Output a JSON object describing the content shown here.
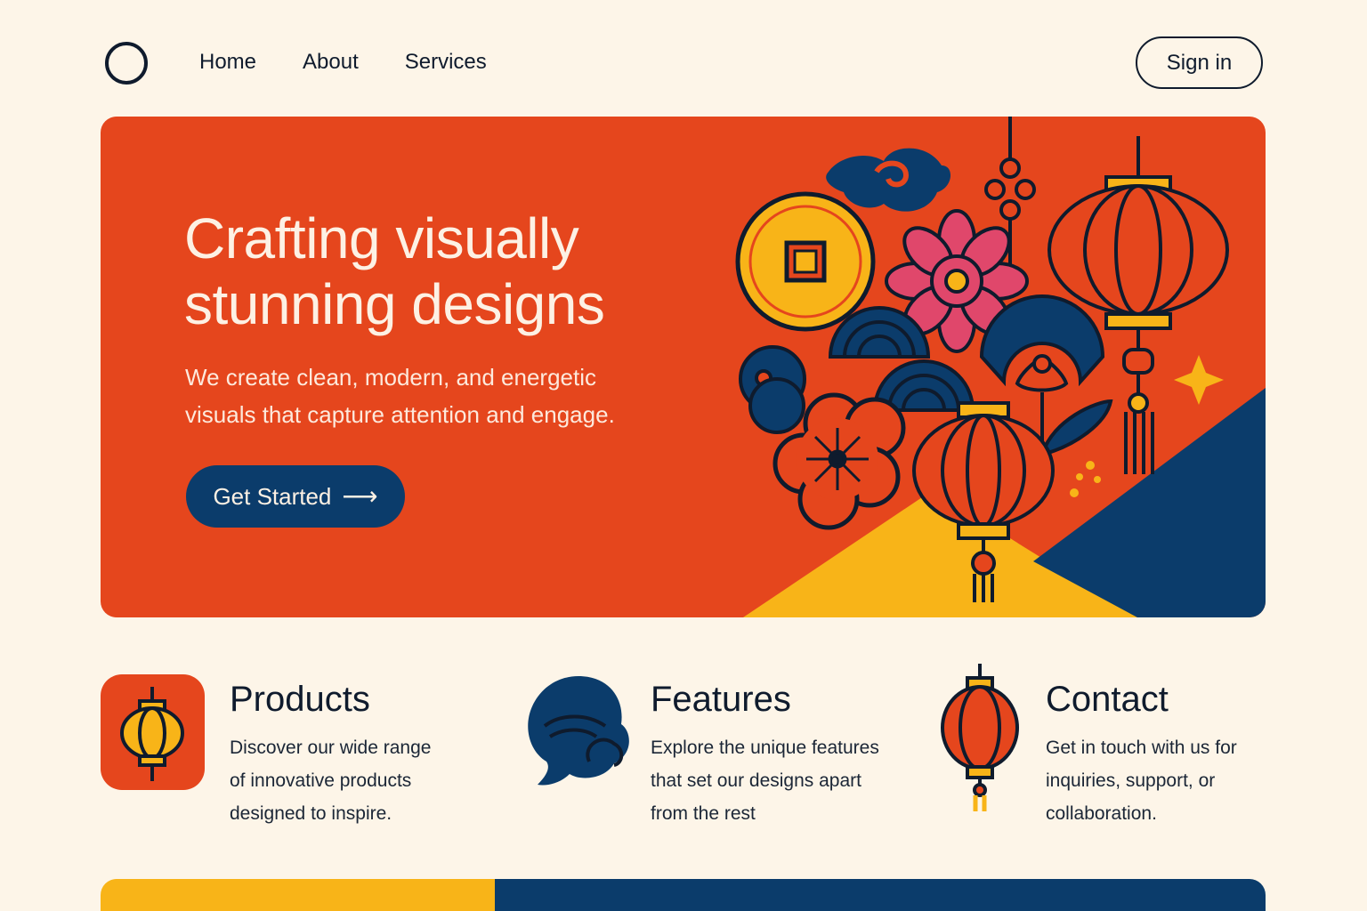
{
  "nav": {
    "links": [
      "Home",
      "About",
      "Services"
    ],
    "signin_label": "Sign in"
  },
  "hero": {
    "title_line1": "Crafting visually",
    "title_line2": "stunning designs",
    "subtitle_line1": "We create clean, modern, and energetic",
    "subtitle_line2": "visuals that capture attention and engage.",
    "cta_label": "Get Started",
    "cta_icon": "arrow-right-icon"
  },
  "features": [
    {
      "title": "Products",
      "desc": [
        "Discover our wide range",
        "of innovative products",
        "designed to inspire."
      ],
      "icon": "lantern-tile-icon"
    },
    {
      "title": "Features",
      "desc": [
        "Explore the unique features",
        "that set our designs apart",
        "from the rest"
      ],
      "icon": "cloud-wave-icon"
    },
    {
      "title": "Contact",
      "desc": [
        "Get in touch with us for",
        "inquiries, support, or",
        "collaboration."
      ],
      "icon": "lantern-icon"
    }
  ],
  "colors": {
    "background": "#fdf5e8",
    "hero_red": "#e5461d",
    "navy": "#0b3c6b",
    "yellow": "#f8b418",
    "pink": "#e0476b",
    "ink": "#0f1b2d"
  }
}
